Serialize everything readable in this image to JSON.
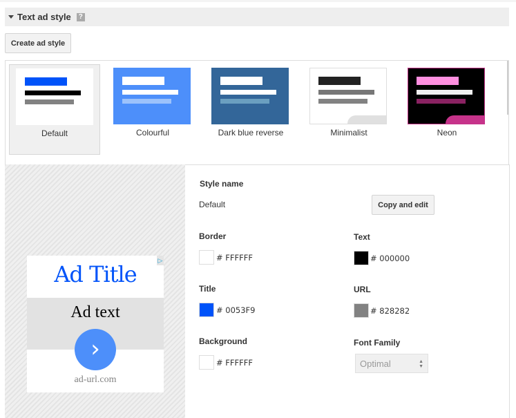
{
  "section": {
    "title": "Text ad style",
    "help_label": "?"
  },
  "create_button": "Create ad style",
  "styles": [
    {
      "label": "Default",
      "selected": true,
      "bg": "#ffffff",
      "border": "#ffffff",
      "bars": [
        "#0053F9",
        "#000000",
        "#828282"
      ],
      "corner": null
    },
    {
      "label": "Colourful",
      "selected": false,
      "bg": "#4d8ffa",
      "border": "#4d8ffa",
      "bars": [
        "#ffffff",
        "#ffffff",
        "#9cc2fb"
      ],
      "corner": null
    },
    {
      "label": "Dark blue reverse",
      "selected": false,
      "bg": "#336699",
      "border": "#336699",
      "bars": [
        "#ffffff",
        "#ffffff",
        "#6b9fc0"
      ],
      "corner": null
    },
    {
      "label": "Minimalist",
      "selected": false,
      "bg": "#ffffff",
      "border": "#dddddd",
      "bars": [
        "#222222",
        "#777777",
        "#828282"
      ],
      "corner": "#e0e0e0"
    },
    {
      "label": "Neon",
      "selected": false,
      "bg": "#000000",
      "border": "#c6338a",
      "bars": [
        "#ff8fe0",
        "#f0f0f0",
        "#8a2262"
      ],
      "corner": "#c6338a"
    }
  ],
  "preview": {
    "title": "Ad Title",
    "text": "Ad text",
    "url": "ad-url.com",
    "adchoices_icon": "adchoices-icon",
    "arrow_icon": "chevron-right-icon"
  },
  "form": {
    "style_name_label": "Style name",
    "style_name_value": "Default",
    "copy_button": "Copy and edit",
    "border": {
      "label": "Border",
      "hex": "# FFFFFF",
      "color": "#FFFFFF"
    },
    "text": {
      "label": "Text",
      "hex": "# 000000",
      "color": "#000000"
    },
    "title": {
      "label": "Title",
      "hex": "# 0053F9",
      "color": "#0053F9"
    },
    "url": {
      "label": "URL",
      "hex": "# 828282",
      "color": "#828282"
    },
    "background": {
      "label": "Background",
      "hex": "# FFFFFF",
      "color": "#FFFFFF"
    },
    "font_family": {
      "label": "Font Family",
      "value": "Optimal"
    }
  }
}
